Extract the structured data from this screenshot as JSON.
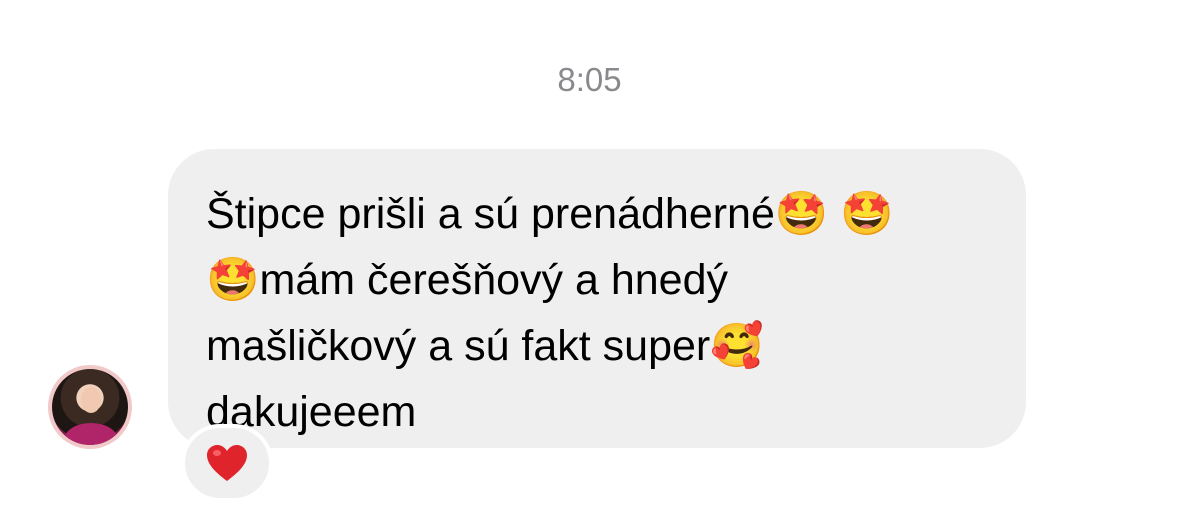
{
  "thread": {
    "timestamp": "8:05"
  },
  "message": {
    "text": "Štipce prišli a sú prenádherné🤩 🤩\n🤩mám čerešňový a hnedý\nmašličkový a sú fakt super🥰\ndakujeeem",
    "reaction_icon": "red-heart",
    "bubble_color": "#efefef"
  },
  "colors": {
    "timestamp_text": "#8a8a8e",
    "heart": "#e0242b"
  }
}
